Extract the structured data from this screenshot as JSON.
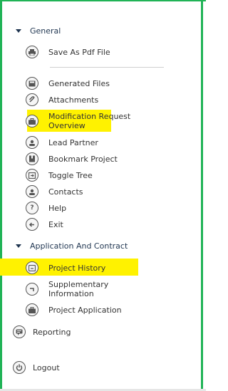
{
  "colors": {
    "frame": "#20b356",
    "highlight": "#fff200",
    "header_text": "#1f3550",
    "text": "#333333"
  },
  "sections": [
    {
      "label": "General"
    },
    {
      "label": "Application And Contract"
    }
  ],
  "general_items": [
    {
      "label": "Save As Pdf File",
      "icon": "printer-icon"
    },
    {
      "label": "Generated Files",
      "icon": "file-icon"
    },
    {
      "label": "Attachments",
      "icon": "paperclip-icon"
    },
    {
      "label": "Modification Request Overview",
      "line1": "Modification Request",
      "line2": "Overview",
      "icon": "briefcase-icon",
      "highlighted": true
    },
    {
      "label": "Lead Partner",
      "icon": "user-icon"
    },
    {
      "label": "Bookmark Project",
      "icon": "bookmark-icon"
    },
    {
      "label": "Toggle Tree",
      "icon": "toggle-icon"
    },
    {
      "label": "Contacts",
      "icon": "contacts-icon"
    },
    {
      "label": "Help",
      "icon": "help-icon"
    },
    {
      "label": "Exit",
      "icon": "exit-icon"
    }
  ],
  "application_items": [
    {
      "label": "Project History",
      "icon": "history-icon",
      "highlighted": true
    },
    {
      "label": "Supplementary Information",
      "line1": "Supplementary",
      "line2": "Information",
      "icon": "info-icon"
    },
    {
      "label": "Project Application",
      "icon": "briefcase-icon"
    }
  ],
  "footer_items": [
    {
      "label": "Reporting",
      "icon": "reporting-icon"
    },
    {
      "label": "Logout",
      "icon": "power-icon"
    }
  ]
}
